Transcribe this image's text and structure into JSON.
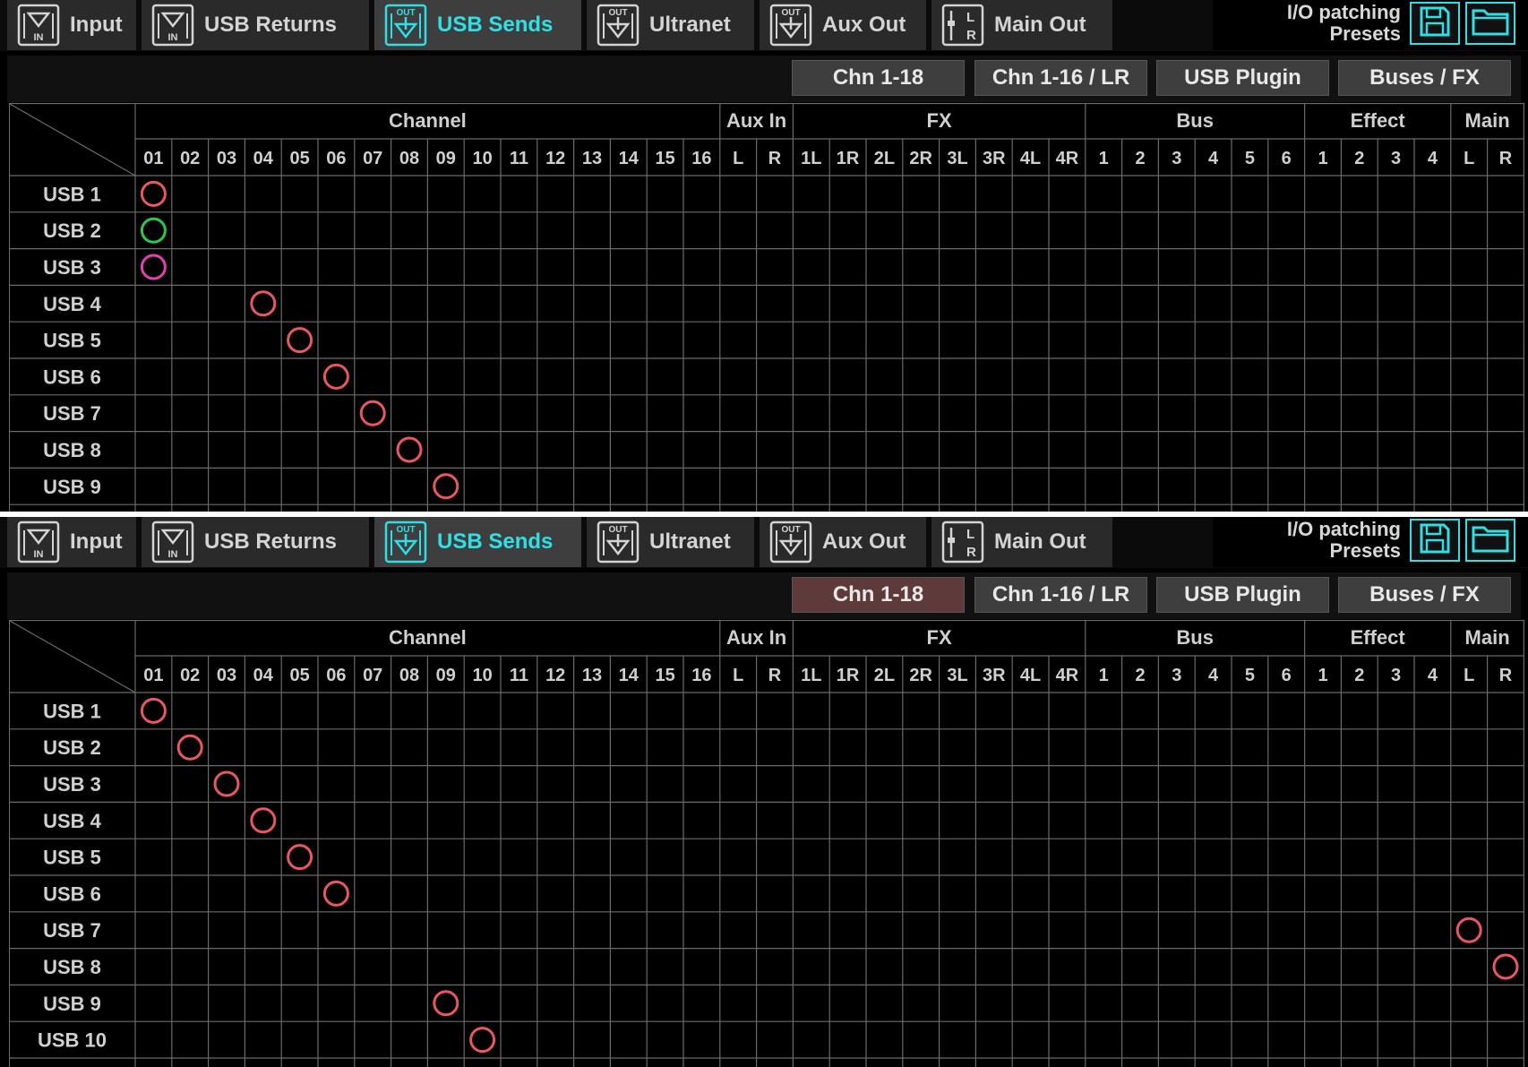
{
  "colors": {
    "accent": "#2ee0e6",
    "patch_red": "#e8585e",
    "patch_green": "#2cc84a",
    "patch_magenta": "#e040b0"
  },
  "tabs": [
    {
      "label": "Input",
      "icon": "in-arrow-icon"
    },
    {
      "label": "USB Returns",
      "icon": "in-arrow-icon"
    },
    {
      "label": "USB Sends",
      "icon": "out-arrow-icon",
      "active": true
    },
    {
      "label": "Ultranet",
      "icon": "out-arrow-icon"
    },
    {
      "label": "Aux Out",
      "icon": "out-arrow-icon"
    },
    {
      "label": "Main Out",
      "icon": "lr-fader-icon"
    }
  ],
  "presets": {
    "line1": "I/O patching",
    "line2": "Presets",
    "save_icon": "floppy-save-icon",
    "load_icon": "folder-open-icon"
  },
  "filters": [
    "Chn 1-18",
    "Chn 1-16 / LR",
    "USB Plugin",
    "Buses / FX"
  ],
  "groups": [
    {
      "label": "Channel"
    },
    {
      "label": "Aux In"
    },
    {
      "label": "FX"
    },
    {
      "label": "Bus"
    },
    {
      "label": "Effect"
    },
    {
      "label": "Main"
    }
  ],
  "columns": [
    "01",
    "02",
    "03",
    "04",
    "05",
    "06",
    "07",
    "08",
    "09",
    "10",
    "11",
    "12",
    "13",
    "14",
    "15",
    "16",
    "L",
    "R",
    "1L",
    "1R",
    "2L",
    "2R",
    "3L",
    "3R",
    "4L",
    "4R",
    "1",
    "2",
    "3",
    "4",
    "5",
    "6",
    "1",
    "2",
    "3",
    "4",
    "L",
    "R"
  ],
  "panels": [
    {
      "active_filter": "",
      "rows": [
        "USB 1",
        "USB 2",
        "USB 3",
        "USB 4",
        "USB 5",
        "USB 6",
        "USB 7",
        "USB 8",
        "USB 9"
      ],
      "patches": [
        {
          "row": "USB 1",
          "column": "01",
          "color": "red"
        },
        {
          "row": "USB 2",
          "column": "01",
          "color": "green"
        },
        {
          "row": "USB 3",
          "column": "01",
          "color": "magenta"
        },
        {
          "row": "USB 4",
          "column": "04",
          "color": "red"
        },
        {
          "row": "USB 5",
          "column": "05",
          "color": "red"
        },
        {
          "row": "USB 6",
          "column": "06",
          "color": "red"
        },
        {
          "row": "USB 7",
          "column": "07",
          "color": "red"
        },
        {
          "row": "USB 8",
          "column": "08",
          "color": "red"
        },
        {
          "row": "USB 9",
          "column": "09",
          "color": "red"
        }
      ]
    },
    {
      "active_filter": "Chn 1-18",
      "rows": [
        "USB 1",
        "USB 2",
        "USB 3",
        "USB 4",
        "USB 5",
        "USB 6",
        "USB 7",
        "USB 8",
        "USB 9",
        "USB 10"
      ],
      "patches": [
        {
          "row": "USB 1",
          "column": "01",
          "color": "red"
        },
        {
          "row": "USB 2",
          "column": "02",
          "color": "red"
        },
        {
          "row": "USB 3",
          "column": "03",
          "color": "red"
        },
        {
          "row": "USB 4",
          "column": "04",
          "color": "red"
        },
        {
          "row": "USB 5",
          "column": "05",
          "color": "red"
        },
        {
          "row": "USB 6",
          "column": "06",
          "color": "red"
        },
        {
          "row": "USB 7",
          "column": "Main L",
          "color": "red"
        },
        {
          "row": "USB 8",
          "column": "Main R",
          "color": "red"
        },
        {
          "row": "USB 9",
          "column": "09",
          "color": "red"
        },
        {
          "row": "USB 10",
          "column": "10",
          "color": "red"
        }
      ]
    }
  ]
}
